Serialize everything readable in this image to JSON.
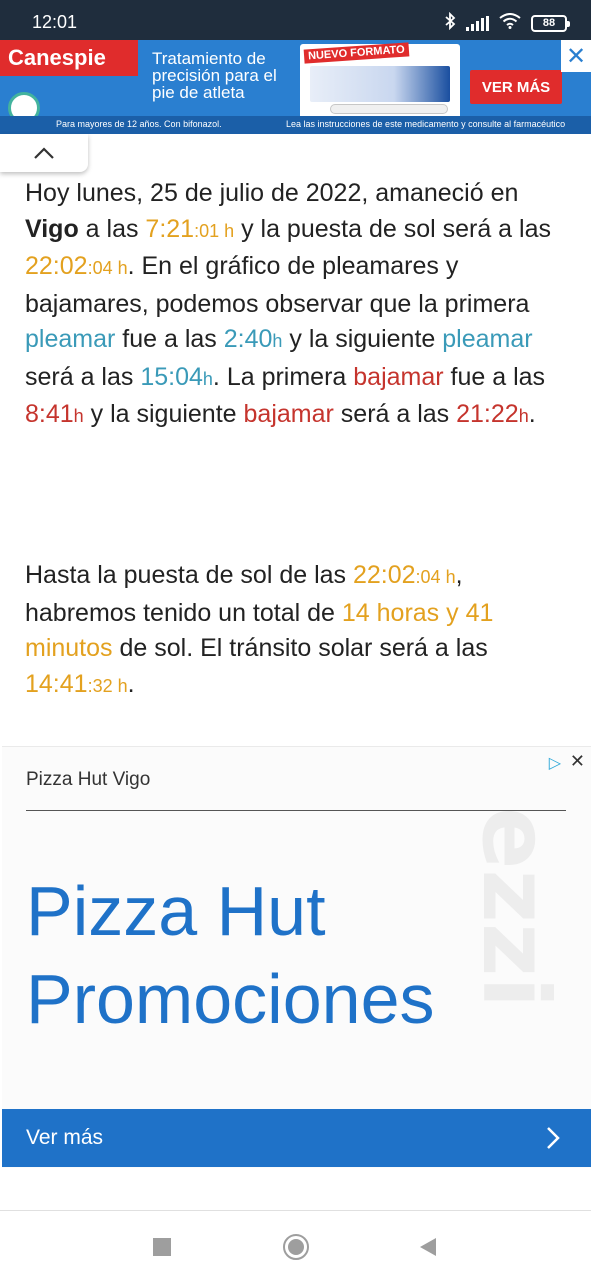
{
  "status_bar": {
    "time": "12:01",
    "battery": "88",
    "icons": [
      "bluetooth-icon",
      "signal-icon",
      "wifi-icon",
      "battery-icon"
    ]
  },
  "top_ad": {
    "brand": "Canespie",
    "headline": "Tratamiento de precisión para el pie de atleta",
    "product_tag": "NUEVO FORMATO",
    "cta": "VER MÁS",
    "footer_left": "Para mayores de 12 años. Con bifonazol.",
    "footer_right": "Lea las instrucciones de este medicamento y consulte al farmacéutico",
    "close_symbol": "✕",
    "colors": {
      "banner": "#2a7fd0",
      "brand": "#e02c2c"
    }
  },
  "article": {
    "p1": {
      "intro": "Hoy lunes, 25 de julio de 2022, amaneció en ",
      "city": "Vigo",
      "at": " a las ",
      "sunrise_hm": "7:21",
      "sunrise_s": ":01 h",
      "sunset_intro": " y la puesta de sol será a las ",
      "sunset_hm": "22:02",
      "sunset_s": ":04 h",
      "chart_text": ". En el gráfico de pleamares y bajamares, podemos observar que la primera ",
      "high_word": "pleamar",
      "was_at": " fue a las ",
      "high1": "2:40",
      "h": "h",
      "next_text": " y la siguiente ",
      "will_be": " será a las ",
      "high2": "15:04",
      "first_low_text": ". La primera ",
      "low_word": "bajamar",
      "low1": "8:41",
      "low2": "21:22",
      "end": "."
    },
    "p2": {
      "intro": "Hasta la puesta de sol de las ",
      "sunset_hm": "22:02",
      "sunset_s": ":04 h",
      "mid": ", habremos tenido un total de ",
      "daylight": "14 horas y 41 minutos",
      "transit_text": " de sol. El tránsito solar será a las ",
      "transit_hm": "14:41",
      "transit_s": ":32 h",
      "end": "."
    },
    "colors": {
      "sun": "#e3a11f",
      "high_tide": "#3a9ab8",
      "low_tide": "#c5342d"
    }
  },
  "pizza_ad": {
    "advertiser": "Pizza Hut Vigo",
    "title_line1": "Pizza Hut",
    "title_line2": "Promociones",
    "watermark": "ezzi",
    "cta": "Ver más",
    "adchoices_symbol": "▷",
    "close_symbol": "✕",
    "colors": {
      "accent": "#1f72c8"
    }
  }
}
